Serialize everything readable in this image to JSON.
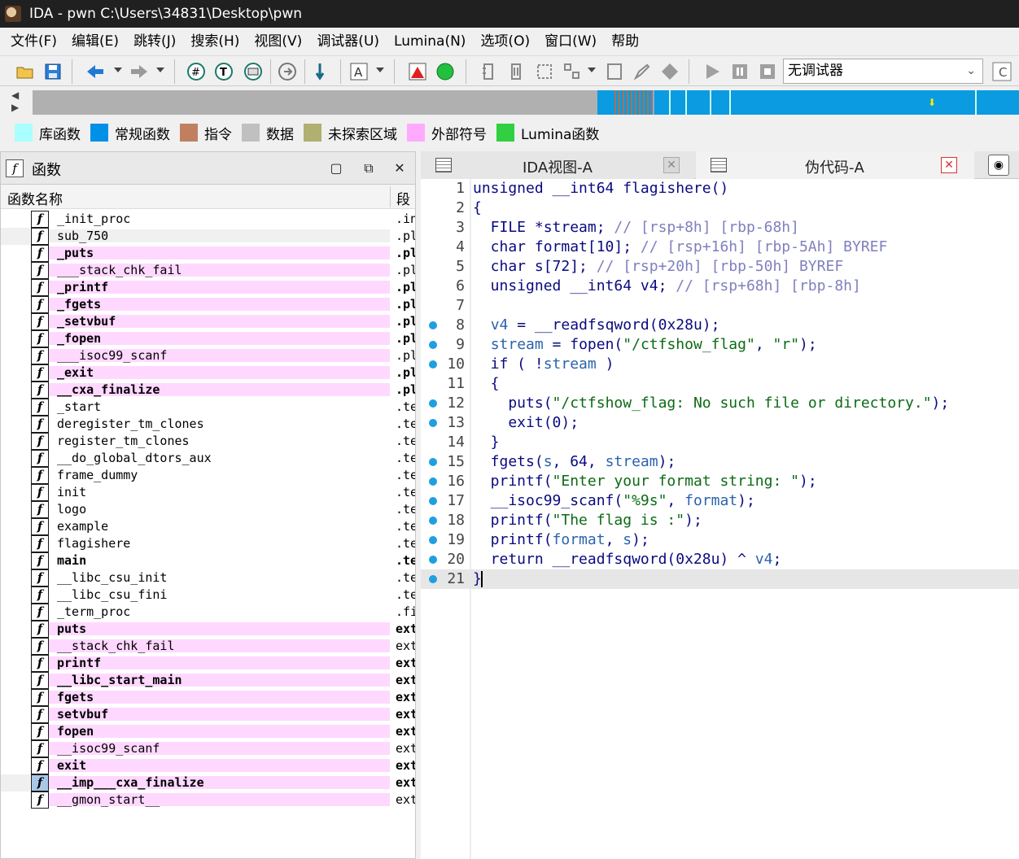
{
  "window": {
    "title": "IDA - pwn C:\\Users\\34831\\Desktop\\pwn"
  },
  "menu": [
    "文件(F)",
    "编辑(E)",
    "跳转(J)",
    "搜索(H)",
    "视图(V)",
    "调试器(U)",
    "Lumina(N)",
    "选项(O)",
    "窗口(W)",
    "帮助"
  ],
  "toolbar": {
    "debugger_select": "无调试器"
  },
  "legend": [
    {
      "label": "库函数",
      "color": "#aaffff"
    },
    {
      "label": "常规函数",
      "color": "#0090e8"
    },
    {
      "label": "指令",
      "color": "#c08060"
    },
    {
      "label": "数据",
      "color": "#c0c0c0"
    },
    {
      "label": "未探索区域",
      "color": "#b0b070"
    },
    {
      "label": "外部符号",
      "color": "#ffaaff"
    },
    {
      "label": "Lumina函数",
      "color": "#30d040"
    }
  ],
  "functions_panel": {
    "title": "函数",
    "col_name": "函数名称",
    "col_segment": "段",
    "rows": [
      {
        "name": "_init_proc",
        "seg": ".in",
        "bold": false,
        "pink": false
      },
      {
        "name": "sub_750",
        "seg": ".pl",
        "bold": false,
        "pink": false
      },
      {
        "name": "_puts",
        "seg": ".pl",
        "bold": true,
        "pink": true
      },
      {
        "name": "___stack_chk_fail",
        "seg": ".pl",
        "bold": false,
        "pink": true
      },
      {
        "name": "_printf",
        "seg": ".pl",
        "bold": true,
        "pink": true
      },
      {
        "name": "_fgets",
        "seg": ".pl",
        "bold": true,
        "pink": true
      },
      {
        "name": "_setvbuf",
        "seg": ".pl",
        "bold": true,
        "pink": true
      },
      {
        "name": "_fopen",
        "seg": ".pl",
        "bold": true,
        "pink": true
      },
      {
        "name": "___isoc99_scanf",
        "seg": ".pl",
        "bold": false,
        "pink": true
      },
      {
        "name": "_exit",
        "seg": ".pl",
        "bold": true,
        "pink": true
      },
      {
        "name": "__cxa_finalize",
        "seg": ".pl",
        "bold": true,
        "pink": true
      },
      {
        "name": "_start",
        "seg": ".te",
        "bold": false,
        "pink": false
      },
      {
        "name": "deregister_tm_clones",
        "seg": ".te",
        "bold": false,
        "pink": false
      },
      {
        "name": "register_tm_clones",
        "seg": ".te",
        "bold": false,
        "pink": false
      },
      {
        "name": "__do_global_dtors_aux",
        "seg": ".te",
        "bold": false,
        "pink": false
      },
      {
        "name": "frame_dummy",
        "seg": ".te",
        "bold": false,
        "pink": false
      },
      {
        "name": "init",
        "seg": ".te",
        "bold": false,
        "pink": false
      },
      {
        "name": "logo",
        "seg": ".te",
        "bold": false,
        "pink": false
      },
      {
        "name": "example",
        "seg": ".te",
        "bold": false,
        "pink": false
      },
      {
        "name": "flagishere",
        "seg": ".te",
        "bold": false,
        "pink": false
      },
      {
        "name": "main",
        "seg": ".te",
        "bold": true,
        "pink": false
      },
      {
        "name": "__libc_csu_init",
        "seg": ".te",
        "bold": false,
        "pink": false
      },
      {
        "name": "__libc_csu_fini",
        "seg": ".te",
        "bold": false,
        "pink": false
      },
      {
        "name": "_term_proc",
        "seg": ".fi",
        "bold": false,
        "pink": false
      },
      {
        "name": "puts",
        "seg": "ext",
        "bold": true,
        "pink": true
      },
      {
        "name": "__stack_chk_fail",
        "seg": "ext",
        "bold": false,
        "pink": true
      },
      {
        "name": "printf",
        "seg": "ext",
        "bold": true,
        "pink": true
      },
      {
        "name": "__libc_start_main",
        "seg": "ext",
        "bold": true,
        "pink": true
      },
      {
        "name": "fgets",
        "seg": "ext",
        "bold": true,
        "pink": true
      },
      {
        "name": "setvbuf",
        "seg": "ext",
        "bold": true,
        "pink": true
      },
      {
        "name": "fopen",
        "seg": "ext",
        "bold": true,
        "pink": true
      },
      {
        "name": "__isoc99_scanf",
        "seg": "ext",
        "bold": false,
        "pink": true
      },
      {
        "name": "exit",
        "seg": "ext",
        "bold": true,
        "pink": true
      },
      {
        "name": "__imp___cxa_finalize",
        "seg": "ext",
        "bold": true,
        "pink": true
      },
      {
        "name": "__gmon_start__",
        "seg": "ext",
        "bold": false,
        "pink": true
      }
    ]
  },
  "tabs": [
    {
      "label": "IDA视图-A"
    },
    {
      "label": "伪代码-A"
    }
  ],
  "pseudocode": [
    {
      "n": "1",
      "dot": false,
      "parts": [
        [
          "kw",
          "unsigned __int64 flagishere()"
        ]
      ]
    },
    {
      "n": "2",
      "dot": false,
      "parts": [
        [
          "kw",
          "{"
        ]
      ]
    },
    {
      "n": "3",
      "dot": false,
      "parts": [
        [
          "kw",
          "  FILE *stream; "
        ],
        [
          "cmt",
          "// [rsp+8h] [rbp-68h]"
        ]
      ]
    },
    {
      "n": "4",
      "dot": false,
      "parts": [
        [
          "kw",
          "  char format[10]; "
        ],
        [
          "cmt",
          "// [rsp+16h] [rbp-5Ah] BYREF"
        ]
      ]
    },
    {
      "n": "5",
      "dot": false,
      "parts": [
        [
          "kw",
          "  char s[72]; "
        ],
        [
          "cmt",
          "// [rsp+20h] [rbp-50h] BYREF"
        ]
      ]
    },
    {
      "n": "6",
      "dot": false,
      "parts": [
        [
          "kw",
          "  unsigned __int64 v4; "
        ],
        [
          "cmt",
          "// [rsp+68h] [rbp-8h]"
        ]
      ]
    },
    {
      "n": "7",
      "dot": false,
      "parts": [
        [
          "kw",
          ""
        ]
      ]
    },
    {
      "n": "8",
      "dot": true,
      "parts": [
        [
          "kw",
          "  "
        ],
        [
          "var",
          "v4"
        ],
        [
          "kw",
          " = __readfsqword(0x28u);"
        ]
      ]
    },
    {
      "n": "9",
      "dot": true,
      "parts": [
        [
          "kw",
          "  "
        ],
        [
          "var",
          "stream"
        ],
        [
          "kw",
          " = fopen("
        ],
        [
          "str",
          "\"/ctfshow_flag\""
        ],
        [
          "kw",
          ", "
        ],
        [
          "str",
          "\"r\""
        ],
        [
          "kw",
          ");"
        ]
      ]
    },
    {
      "n": "10",
      "dot": true,
      "parts": [
        [
          "kw",
          "  if ( !"
        ],
        [
          "var",
          "stream"
        ],
        [
          "kw",
          " )"
        ]
      ]
    },
    {
      "n": "11",
      "dot": false,
      "parts": [
        [
          "kw",
          "  {"
        ]
      ]
    },
    {
      "n": "12",
      "dot": true,
      "parts": [
        [
          "kw",
          "    puts("
        ],
        [
          "str",
          "\"/ctfshow_flag: No such file or directory.\""
        ],
        [
          "kw",
          ");"
        ]
      ]
    },
    {
      "n": "13",
      "dot": true,
      "parts": [
        [
          "kw",
          "    exit(0);"
        ]
      ]
    },
    {
      "n": "14",
      "dot": false,
      "parts": [
        [
          "kw",
          "  }"
        ]
      ]
    },
    {
      "n": "15",
      "dot": true,
      "parts": [
        [
          "kw",
          "  fgets("
        ],
        [
          "var",
          "s"
        ],
        [
          "kw",
          ", 64, "
        ],
        [
          "var",
          "stream"
        ],
        [
          "kw",
          ");"
        ]
      ]
    },
    {
      "n": "16",
      "dot": true,
      "parts": [
        [
          "kw",
          "  printf("
        ],
        [
          "str",
          "\"Enter your format string: \""
        ],
        [
          "kw",
          ");"
        ]
      ]
    },
    {
      "n": "17",
      "dot": true,
      "parts": [
        [
          "kw",
          "  __isoc99_scanf("
        ],
        [
          "str",
          "\"%9s\""
        ],
        [
          "kw",
          ", "
        ],
        [
          "var",
          "format"
        ],
        [
          "kw",
          ");"
        ]
      ]
    },
    {
      "n": "18",
      "dot": true,
      "parts": [
        [
          "kw",
          "  printf("
        ],
        [
          "str",
          "\"The flag is :\""
        ],
        [
          "kw",
          ");"
        ]
      ]
    },
    {
      "n": "19",
      "dot": true,
      "parts": [
        [
          "kw",
          "  printf("
        ],
        [
          "var",
          "format"
        ],
        [
          "kw",
          ", "
        ],
        [
          "var",
          "s"
        ],
        [
          "kw",
          ");"
        ]
      ]
    },
    {
      "n": "20",
      "dot": true,
      "parts": [
        [
          "kw",
          "  return __readfsqword(0x28u) ^ "
        ],
        [
          "var",
          "v4"
        ],
        [
          "kw",
          ";"
        ]
      ]
    },
    {
      "n": "21",
      "dot": true,
      "parts": [
        [
          "kw",
          "}"
        ]
      ]
    }
  ]
}
